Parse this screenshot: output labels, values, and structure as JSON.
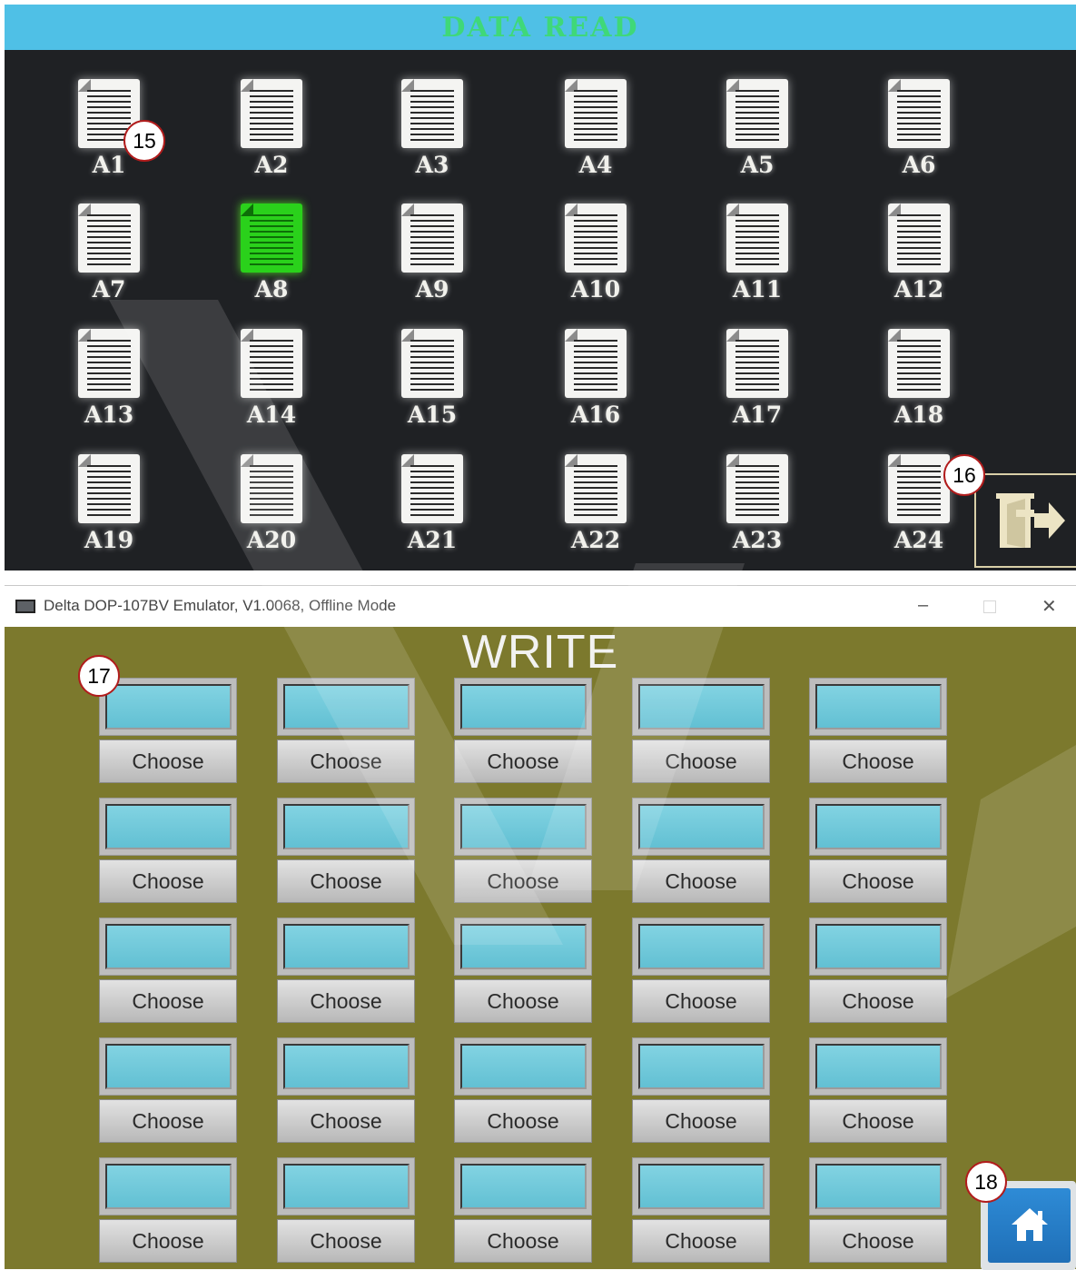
{
  "read_screen": {
    "title": "DATA READ",
    "files": [
      "A1",
      "A2",
      "A3",
      "A4",
      "A5",
      "A6",
      "A7",
      "A8",
      "A9",
      "A10",
      "A11",
      "A12",
      "A13",
      "A14",
      "A15",
      "A16",
      "A17",
      "A18",
      "A19",
      "A20",
      "A21",
      "A22",
      "A23",
      "A24"
    ],
    "selected_file": "A8",
    "exit_button_icon": "exit-door-icon"
  },
  "write_screen": {
    "window_title": "Delta DOP-107BV Emulator, V1.0068, Offline Mode",
    "minimize_glyph": "–",
    "close_glyph": "✕",
    "title": "WRITE",
    "choose_label": "Choose",
    "slot_count": 25,
    "home_button_icon": "home-icon"
  },
  "markers": [
    "15",
    "16",
    "17",
    "18"
  ],
  "colors": {
    "read_background": "#1f2124",
    "read_header": "#4fc0e6",
    "read_title": "#3fd879",
    "selected_file": "#2ad11b",
    "write_background": "#7c792d",
    "field_fill": "#6fc9da",
    "home_button": "#1f6fb7",
    "marker_border": "#b11c1c"
  }
}
